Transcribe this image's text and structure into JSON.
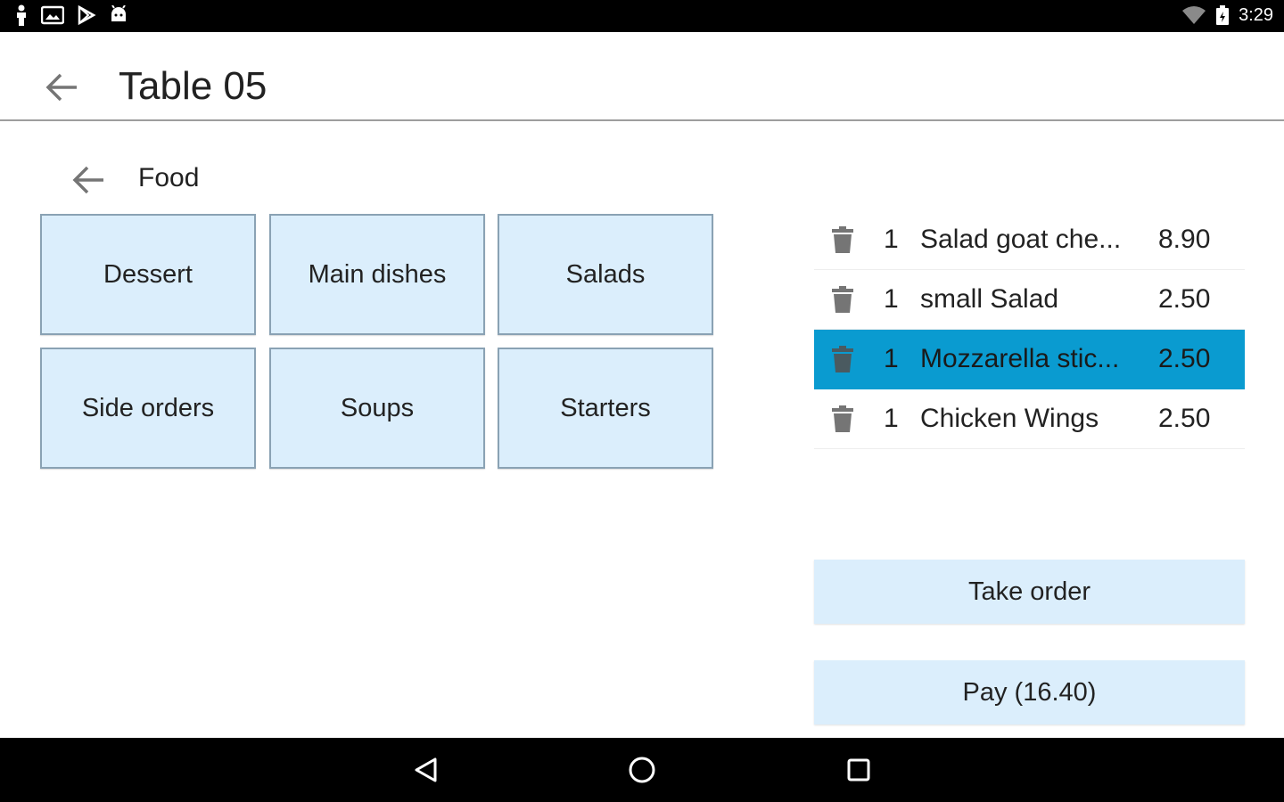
{
  "status_bar": {
    "time": "3:29",
    "left_icons": [
      "person-icon",
      "photo-icon",
      "play-store-icon",
      "android-icon"
    ],
    "right_icons": [
      "wifi-icon",
      "battery-icon"
    ]
  },
  "app_bar": {
    "title": "Table 05",
    "back_icon": "arrow-back-icon"
  },
  "breadcrumb": {
    "label": "Food",
    "back_icon": "arrow-back-icon"
  },
  "categories": [
    {
      "label": "Dessert"
    },
    {
      "label": "Main dishes"
    },
    {
      "label": "Salads"
    },
    {
      "label": "Side orders"
    },
    {
      "label": "Soups"
    },
    {
      "label": "Starters"
    }
  ],
  "order_items": [
    {
      "qty": "1",
      "name": "Salad goat che...",
      "price": "8.90",
      "selected": false
    },
    {
      "qty": "1",
      "name": "small Salad",
      "price": "2.50",
      "selected": false
    },
    {
      "qty": "1",
      "name": "Mozzarella stic...",
      "price": "2.50",
      "selected": true
    },
    {
      "qty": "1",
      "name": "Chicken Wings",
      "price": "2.50",
      "selected": false
    }
  ],
  "actions": {
    "take_order_label": "Take order",
    "pay_label": "Pay (16.40)"
  },
  "colors": {
    "tile_bg": "#dbeefc",
    "selected_row": "#0a9bd0",
    "icon_gray": "#757575"
  },
  "nav_bar": {
    "icons": [
      "back-triangle-icon",
      "home-circle-icon",
      "recents-square-icon"
    ]
  }
}
